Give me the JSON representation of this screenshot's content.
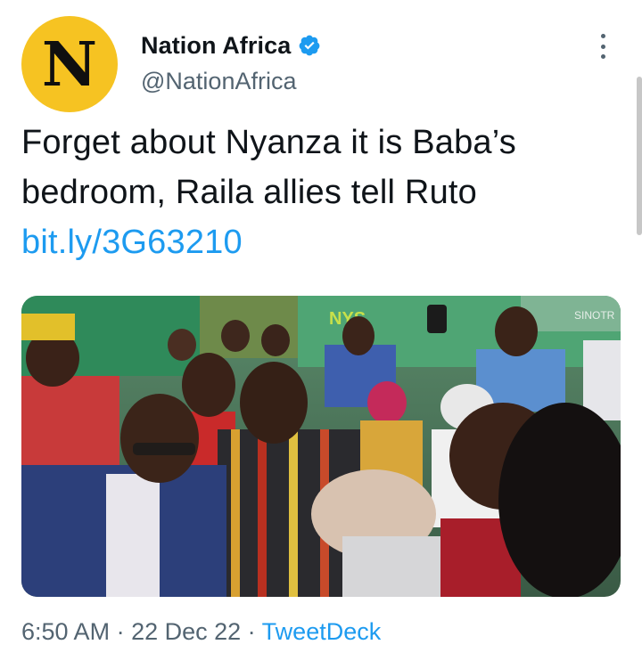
{
  "author": {
    "avatar_letter": "N",
    "avatar_color": "#f6c322",
    "display_name": "Nation Africa",
    "handle": "@NationAfrica",
    "verified": true
  },
  "tweet": {
    "text_line_1": "Forget about Nyanza it is Baba’s",
    "text_line_2": "bedroom, Raila allies tell Ruto",
    "link": "bit.ly/3G63210"
  },
  "media": {
    "truck_text_1": "NYS",
    "truck_text_2": "SINOTR"
  },
  "footer": {
    "time": "6:50 AM",
    "separator_1": " · ",
    "date": "22 Dec 22",
    "separator_2": " · ",
    "source": "TweetDeck"
  },
  "colors": {
    "link": "#1d9bf0",
    "secondary_text": "#536471",
    "primary_text": "#0f1419"
  }
}
